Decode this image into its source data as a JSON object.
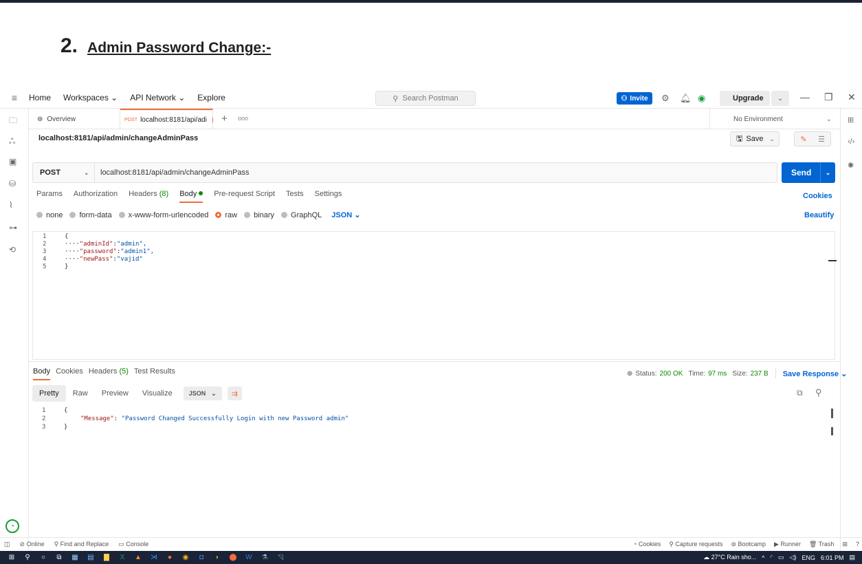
{
  "doc": {
    "number": "2.",
    "title": "Admin Password Change:-"
  },
  "header": {
    "nav": [
      "Home",
      "Workspaces",
      "API Network",
      "Explore"
    ],
    "search_placeholder": "Search Postman",
    "invite": "Invite",
    "upgrade": "Upgrade"
  },
  "tabs": {
    "overview": "Overview",
    "active_method": "POST",
    "active_label": "localhost:8181/api/adi",
    "environment": "No Environment"
  },
  "request": {
    "breadcrumb": "localhost:8181/api/admin/changeAdminPass",
    "save": "Save",
    "method": "POST",
    "url": "localhost:8181/api/admin/changeAdminPass",
    "send": "Send",
    "tabs": [
      "Params",
      "Authorization",
      "Headers",
      "Body",
      "Pre-request Script",
      "Tests",
      "Settings"
    ],
    "headers_count": "(8)",
    "cookies": "Cookies",
    "body_modes": [
      "none",
      "form-data",
      "x-www-form-urlencoded",
      "raw",
      "binary",
      "GraphQL"
    ],
    "body_format": "JSON",
    "beautify": "Beautify",
    "body_lines": [
      {
        "n": "1",
        "text": "{"
      },
      {
        "n": "2",
        "key": "\"adminId\"",
        "val": "\"admin\","
      },
      {
        "n": "3",
        "key": "\"password\"",
        "val": "\"admin1\","
      },
      {
        "n": "4",
        "key": "\"newPass\"",
        "val": "\"vajid\""
      },
      {
        "n": "5",
        "text": "}"
      }
    ]
  },
  "response": {
    "tabs": [
      "Body",
      "Cookies",
      "Headers",
      "Test Results"
    ],
    "headers_count": "(5)",
    "status_label": "Status:",
    "status": "200 OK",
    "time_label": "Time:",
    "time": "97 ms",
    "size_label": "Size:",
    "size": "237 B",
    "save_response": "Save Response",
    "views": [
      "Pretty",
      "Raw",
      "Preview",
      "Visualize"
    ],
    "format": "JSON",
    "lines": [
      {
        "n": "1",
        "text": "{"
      },
      {
        "n": "2",
        "key": "\"Message\"",
        "val": "\"Password Changed Successfully Login with new Password admin\""
      },
      {
        "n": "3",
        "text": "}"
      }
    ]
  },
  "statusbar": {
    "online": "Online",
    "find": "Find and Replace",
    "console": "Console",
    "right": [
      "Cookies",
      "Capture requests",
      "Bootcamp",
      "Runner",
      "Trash"
    ]
  },
  "taskbar": {
    "weather": "27°C  Rain sho...",
    "lang": "ENG",
    "time": "6:01 PM"
  },
  "colors": {
    "accent": "#f26b3a",
    "primary": "#0265d2",
    "success": "#0b8a00"
  }
}
